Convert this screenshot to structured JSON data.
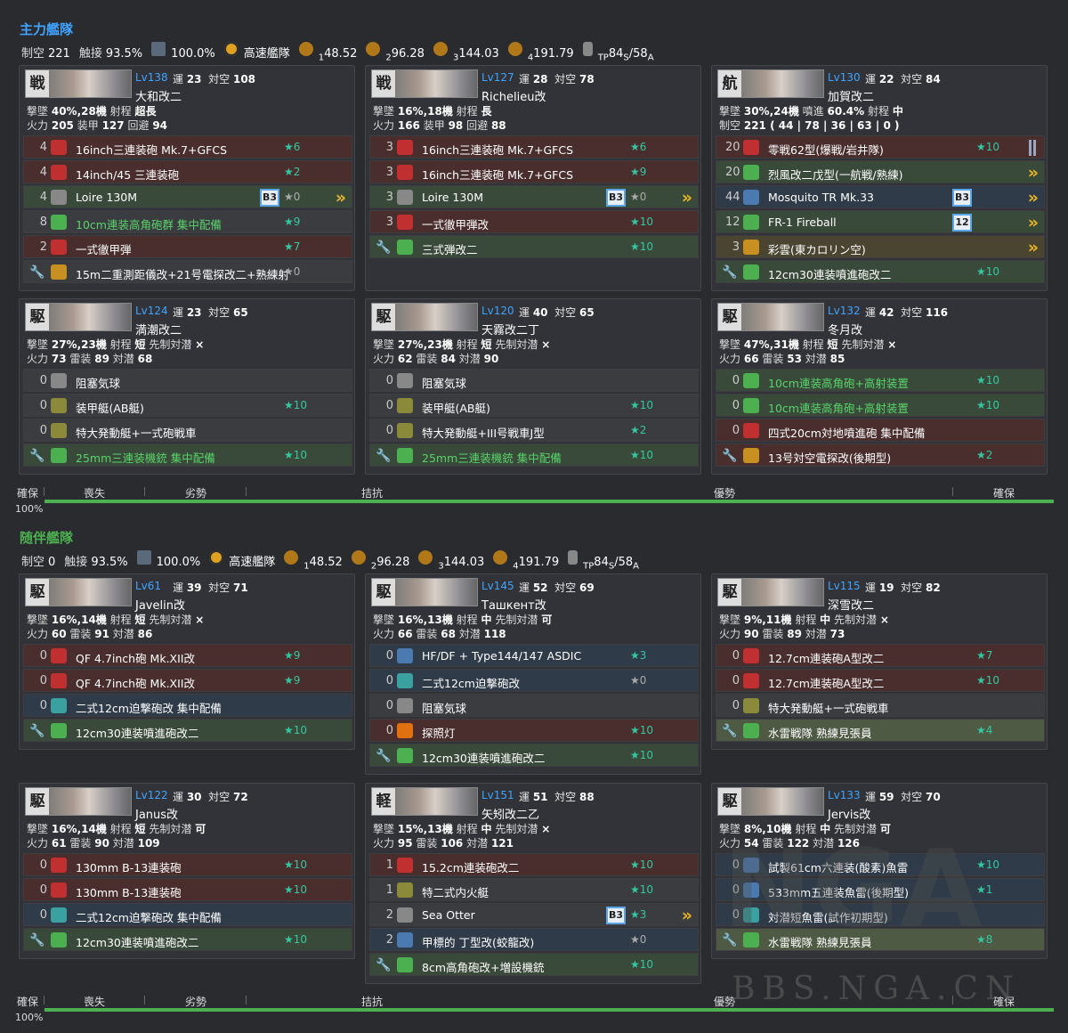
{
  "fleets": [
    {
      "title": "主力艦隊",
      "title_color": "#3fa4ff",
      "stats": {
        "aa_label": "制空",
        "aa": "221",
        "contact_label": "触接",
        "contact": "93.5%",
        "night_contact": "100.0%",
        "speed": "高速艦隊",
        "los": [
          {
            "n": "1",
            "v": "48.52"
          },
          {
            "n": "2",
            "v": "96.28"
          },
          {
            "n": "3",
            "v": "144.03"
          },
          {
            "n": "4",
            "v": "191.79"
          }
        ],
        "tp_label": "TP",
        "tp": "84",
        "tp_s": "S",
        "tp_a": "58",
        "tp_a_s": "A",
        "slash": "/"
      },
      "ships": [
        {
          "type": "戦",
          "lv": "Lv138",
          "luck": "23",
          "aa": "108",
          "name": "大和改二",
          "l1": [
            [
              "撃墜",
              "40%,28機"
            ],
            [
              "射程",
              "超長"
            ]
          ],
          "l2": [
            [
              "火力",
              "205"
            ],
            [
              "装甲",
              "127"
            ],
            [
              "回避",
              "94"
            ]
          ],
          "eq": [
            {
              "c": "4",
              "i": "red",
              "n": "16inch三連装砲 Mk.7+GFCS",
              "s": "★6",
              "bg": "red"
            },
            {
              "c": "4",
              "i": "red",
              "n": "14inch/45 三連装砲",
              "s": "★2",
              "bg": "red"
            },
            {
              "c": "4",
              "i": "grey",
              "n": "Loire 130M",
              "s": "★0",
              "bg": "green",
              "p": "B3",
              "chev": 1
            },
            {
              "c": "8",
              "i": "green",
              "n": "10cm連装高角砲群 集中配備",
              "s": "★9",
              "bg": "grey",
              "g": 1
            },
            {
              "c": "2",
              "i": "red",
              "n": "一式徹甲弾",
              "s": "★7",
              "bg": "red"
            },
            {
              "w": 1,
              "i": "yellow",
              "n": "15m二重測距儀改+21号電探改二+熟練射",
              "s": "★0",
              "bg": "grey"
            }
          ]
        },
        {
          "type": "戦",
          "lv": "Lv127",
          "luck": "28",
          "aa": "78",
          "name": "Richelieu改",
          "l1": [
            [
              "撃墜",
              "16%,18機"
            ],
            [
              "射程",
              "長"
            ]
          ],
          "l2": [
            [
              "火力",
              "166"
            ],
            [
              "装甲",
              "98"
            ],
            [
              "回避",
              "88"
            ]
          ],
          "eq": [
            {
              "c": "3",
              "i": "red",
              "n": "16inch三連装砲 Mk.7+GFCS",
              "s": "★6",
              "bg": "red"
            },
            {
              "c": "3",
              "i": "red",
              "n": "16inch三連装砲 Mk.7+GFCS",
              "s": "★9",
              "bg": "red"
            },
            {
              "c": "3",
              "i": "grey",
              "n": "Loire 130M",
              "s": "★0",
              "bg": "green",
              "p": "B3",
              "chev": 1
            },
            {
              "c": "3",
              "i": "red",
              "n": "一式徹甲弾改",
              "s": "★10",
              "bg": "red"
            },
            {
              "w": 1,
              "i": "green",
              "n": "三式弾改二",
              "s": "★10",
              "bg": "green"
            }
          ]
        },
        {
          "type": "航",
          "lv": "Lv130",
          "luck": "22",
          "aa": "84",
          "name": "加賀改二",
          "l1": [
            [
              "撃墜",
              "30%,24機"
            ],
            [
              "噴進",
              "60.4%"
            ],
            [
              "射程",
              "中"
            ]
          ],
          "l2": [
            [
              "制空",
              "221 ( 44 | 78 | 36 | 63 | 0 )"
            ]
          ],
          "eq": [
            {
              "c": "20",
              "i": "red",
              "n": "零戦62型(爆戦/岩井隊)",
              "s": "★10",
              "bg": "red",
              "bar": 1
            },
            {
              "c": "20",
              "i": "green",
              "n": "烈風改二戊型(一航戦/熟練)",
              "s": "",
              "bg": "green",
              "chev": 1
            },
            {
              "c": "44",
              "i": "blue",
              "n": "Mosquito TR Mk.33",
              "s": "",
              "bg": "blue",
              "p": "B3",
              "chev": 1
            },
            {
              "c": "12",
              "i": "green",
              "n": "FR-1 Fireball",
              "s": "",
              "bg": "green",
              "p": "12",
              "chev": 1
            },
            {
              "c": "3",
              "i": "yellow",
              "n": "彩雲(東カロリン空)",
              "s": "",
              "bg": "yellow",
              "chev": 1
            },
            {
              "w": 1,
              "i": "green",
              "n": "12cm30連装噴進砲改二",
              "s": "★10",
              "bg": "green"
            }
          ]
        },
        {
          "type": "駆",
          "lv": "Lv124",
          "luck": "23",
          "aa": "65",
          "name": "満潮改二",
          "l1": [
            [
              "撃墜",
              "27%,23機"
            ],
            [
              "射程",
              "短"
            ],
            [
              "先制対潜",
              "×"
            ]
          ],
          "l2": [
            [
              "火力",
              "73"
            ],
            [
              "雷装",
              "89"
            ],
            [
              "対潜",
              "68"
            ]
          ],
          "eq": [
            {
              "c": "0",
              "i": "grey",
              "n": "阻塞気球",
              "s": "",
              "bg": "grey"
            },
            {
              "c": "0",
              "i": "olive",
              "n": "装甲艇(AB艇)",
              "s": "★10",
              "bg": "grey"
            },
            {
              "c": "0",
              "i": "olive",
              "n": "特大発動艇+一式砲戦車",
              "s": "",
              "bg": "grey"
            },
            {
              "w": 1,
              "i": "green",
              "n": "25mm三連装機銃 集中配備",
              "s": "★10",
              "bg": "green",
              "g": 1
            }
          ]
        },
        {
          "type": "駆",
          "lv": "Lv120",
          "luck": "40",
          "aa": "65",
          "name": "天霧改二丁",
          "l1": [
            [
              "撃墜",
              "27%,23機"
            ],
            [
              "射程",
              "短"
            ],
            [
              "先制対潜",
              "×"
            ]
          ],
          "l2": [
            [
              "火力",
              "62"
            ],
            [
              "雷装",
              "84"
            ],
            [
              "対潜",
              "90"
            ]
          ],
          "eq": [
            {
              "c": "0",
              "i": "grey",
              "n": "阻塞気球",
              "s": "",
              "bg": "grey"
            },
            {
              "c": "0",
              "i": "olive",
              "n": "装甲艇(AB艇)",
              "s": "★10",
              "bg": "grey"
            },
            {
              "c": "0",
              "i": "olive",
              "n": "特大発動艇+III号戦車J型",
              "s": "★2",
              "bg": "grey"
            },
            {
              "w": 1,
              "i": "green",
              "n": "25mm三連装機銃 集中配備",
              "s": "★10",
              "bg": "green",
              "g": 1
            }
          ]
        },
        {
          "type": "駆",
          "lv": "Lv132",
          "luck": "42",
          "aa": "116",
          "name": "冬月改",
          "l1": [
            [
              "撃墜",
              "47%,31機"
            ],
            [
              "射程",
              "短"
            ],
            [
              "先制対潜",
              "×"
            ]
          ],
          "l2": [
            [
              "火力",
              "66"
            ],
            [
              "雷装",
              "53"
            ],
            [
              "対潜",
              "85"
            ]
          ],
          "eq": [
            {
              "c": "0",
              "i": "green",
              "n": "10cm連装高角砲+高射装置",
              "s": "★10",
              "bg": "green",
              "g": 1
            },
            {
              "c": "0",
              "i": "green",
              "n": "10cm連装高角砲+高射装置",
              "s": "★10",
              "bg": "green",
              "g": 1
            },
            {
              "c": "0",
              "i": "red",
              "n": "四式20cm対地噴進砲 集中配備",
              "s": "",
              "bg": "red"
            },
            {
              "w": 1,
              "i": "yellow",
              "n": "13号対空電探改(後期型)",
              "s": "★2",
              "bg": "red"
            }
          ]
        }
      ],
      "bar": {
        "labels": [
          "確保",
          "喪失",
          "劣勢",
          "拮抗",
          "優勢",
          "確保"
        ],
        "pct": "100%"
      }
    },
    {
      "title": "随伴艦隊",
      "title_color": "#4caf50",
      "stats": {
        "aa_label": "制空",
        "aa": "0",
        "contact_label": "触接",
        "contact": "93.5%",
        "night_contact": "100.0%",
        "speed": "高速艦隊",
        "los": [
          {
            "n": "1",
            "v": "48.52"
          },
          {
            "n": "2",
            "v": "96.28"
          },
          {
            "n": "3",
            "v": "144.03"
          },
          {
            "n": "4",
            "v": "191.79"
          }
        ],
        "tp_label": "TP",
        "tp": "84",
        "tp_s": "S",
        "tp_a": "58",
        "tp_a_s": "A",
        "slash": "/"
      },
      "ships": [
        {
          "type": "駆",
          "lv": "Lv61",
          "luck": "39",
          "aa": "71",
          "name": "Javelin改",
          "l1": [
            [
              "撃墜",
              "16%,14機"
            ],
            [
              "射程",
              "短"
            ],
            [
              "先制対潜",
              "×"
            ]
          ],
          "l2": [
            [
              "火力",
              "60"
            ],
            [
              "雷装",
              "91"
            ],
            [
              "対潜",
              "86"
            ]
          ],
          "eq": [
            {
              "c": "0",
              "i": "red",
              "n": "QF 4.7inch砲 Mk.XII改",
              "s": "★9",
              "bg": "red"
            },
            {
              "c": "0",
              "i": "red",
              "n": "QF 4.7inch砲 Mk.XII改",
              "s": "★9",
              "bg": "red"
            },
            {
              "c": "0",
              "i": "teal",
              "n": "二式12cm迫撃砲改 集中配備",
              "s": "",
              "bg": "blue"
            },
            {
              "w": 1,
              "i": "green",
              "n": "12cm30連装噴進砲改二",
              "s": "★10",
              "bg": "green"
            }
          ]
        },
        {
          "type": "駆",
          "lv": "Lv145",
          "luck": "52",
          "aa": "69",
          "name": "Ташкент改",
          "l1": [
            [
              "撃墜",
              "16%,13機"
            ],
            [
              "射程",
              "中"
            ],
            [
              "先制対潜",
              "可"
            ]
          ],
          "l2": [
            [
              "火力",
              "66"
            ],
            [
              "雷装",
              "68"
            ],
            [
              "対潜",
              "118"
            ]
          ],
          "eq": [
            {
              "c": "0",
              "i": "blue",
              "n": "HF/DF + Type144/147 ASDIC",
              "s": "★3",
              "bg": "blue"
            },
            {
              "c": "0",
              "i": "teal",
              "n": "二式12cm迫撃砲改",
              "s": "★0",
              "bg": "blue",
              "z": 1
            },
            {
              "c": "0",
              "i": "grey",
              "n": "阻塞気球",
              "s": "",
              "bg": "grey"
            },
            {
              "c": "0",
              "i": "orange",
              "n": "探照灯",
              "s": "★10",
              "bg": "red"
            },
            {
              "w": 1,
              "i": "green",
              "n": "12cm30連装噴進砲改二",
              "s": "★10",
              "bg": "green"
            }
          ]
        },
        {
          "type": "駆",
          "lv": "Lv115",
          "luck": "19",
          "aa": "82",
          "name": "深雪改二",
          "l1": [
            [
              "撃墜",
              "9%,11機"
            ],
            [
              "射程",
              "中"
            ],
            [
              "先制対潜",
              "×"
            ]
          ],
          "l2": [
            [
              "火力",
              "90"
            ],
            [
              "雷装",
              "89"
            ],
            [
              "対潜",
              "73"
            ]
          ],
          "eq": [
            {
              "c": "0",
              "i": "red",
              "n": "12.7cm連装砲A型改二",
              "s": "★7",
              "bg": "red"
            },
            {
              "c": "0",
              "i": "red",
              "n": "12.7cm連装砲A型改二",
              "s": "★10",
              "bg": "red"
            },
            {
              "c": "0",
              "i": "olive",
              "n": "特大発動艇+一式砲戦車",
              "s": "",
              "bg": "grey"
            },
            {
              "w": 1,
              "i": "green",
              "n": "水雷戦隊 熟練見張員",
              "s": "★4",
              "bg": "lgreen"
            }
          ]
        },
        {
          "type": "駆",
          "lv": "Lv122",
          "luck": "30",
          "aa": "72",
          "name": "Janus改",
          "l1": [
            [
              "撃墜",
              "16%,14機"
            ],
            [
              "射程",
              "短"
            ],
            [
              "先制対潜",
              "可"
            ]
          ],
          "l2": [
            [
              "火力",
              "61"
            ],
            [
              "雷装",
              "90"
            ],
            [
              "対潜",
              "109"
            ]
          ],
          "eq": [
            {
              "c": "0",
              "i": "red",
              "n": "130mm B-13連装砲",
              "s": "★10",
              "bg": "red"
            },
            {
              "c": "0",
              "i": "red",
              "n": "130mm B-13連装砲",
              "s": "★10",
              "bg": "red"
            },
            {
              "c": "0",
              "i": "teal",
              "n": "二式12cm迫撃砲改 集中配備",
              "s": "",
              "bg": "blue"
            },
            {
              "w": 1,
              "i": "green",
              "n": "12cm30連装噴進砲改二",
              "s": "★10",
              "bg": "green"
            }
          ]
        },
        {
          "type": "軽",
          "lv": "Lv151",
          "luck": "51",
          "aa": "88",
          "name": "矢矧改二乙",
          "l1": [
            [
              "撃墜",
              "15%,13機"
            ],
            [
              "射程",
              "中"
            ],
            [
              "先制対潜",
              "×"
            ]
          ],
          "l2": [
            [
              "火力",
              "95"
            ],
            [
              "雷装",
              "106"
            ],
            [
              "対潜",
              "121"
            ]
          ],
          "eq": [
            {
              "c": "1",
              "i": "red",
              "n": "15.2cm連装砲改二",
              "s": "★10",
              "bg": "red"
            },
            {
              "c": "1",
              "i": "olive",
              "n": "特二式内火艇",
              "s": "★10",
              "bg": "grey"
            },
            {
              "c": "2",
              "i": "grey",
              "n": "Sea Otter",
              "s": "★3",
              "bg": "grey",
              "p": "B3",
              "chev": 1
            },
            {
              "c": "2",
              "i": "blue",
              "n": "甲標的 丁型改(蛟龍改)",
              "s": "★0",
              "bg": "blue",
              "z": 1
            },
            {
              "w": 1,
              "i": "green",
              "n": "8cm高角砲改+増設機銃",
              "s": "★10",
              "bg": "green"
            }
          ]
        },
        {
          "type": "駆",
          "lv": "Lv133",
          "luck": "59",
          "aa": "70",
          "name": "Jervis改",
          "l1": [
            [
              "撃墜",
              "8%,10機"
            ],
            [
              "射程",
              "中"
            ],
            [
              "先制対潜",
              "可"
            ]
          ],
          "l2": [
            [
              "火力",
              "54"
            ],
            [
              "雷装",
              "122"
            ],
            [
              "対潜",
              "126"
            ]
          ],
          "eq": [
            {
              "c": "0",
              "i": "blue",
              "n": "試製61cm六連装(酸素)魚雷",
              "s": "★10",
              "bg": "blue"
            },
            {
              "c": "0",
              "i": "blue",
              "n": "533mm五連装魚雷(後期型)",
              "s": "★1",
              "bg": "blue"
            },
            {
              "c": "0",
              "i": "teal",
              "n": "対潜短魚雷(試作初期型)",
              "s": "",
              "bg": "blue"
            },
            {
              "w": 1,
              "i": "green",
              "n": "水雷戦隊 熟練見張員",
              "s": "★8",
              "bg": "lgreen"
            }
          ]
        }
      ],
      "bar": {
        "labels": [
          "確保",
          "喪失",
          "劣勢",
          "拮抗",
          "優勢",
          "確保"
        ],
        "pct": "100%"
      }
    }
  ],
  "watermark": "BBS.NGA.CN",
  "watermark2": "NGA"
}
